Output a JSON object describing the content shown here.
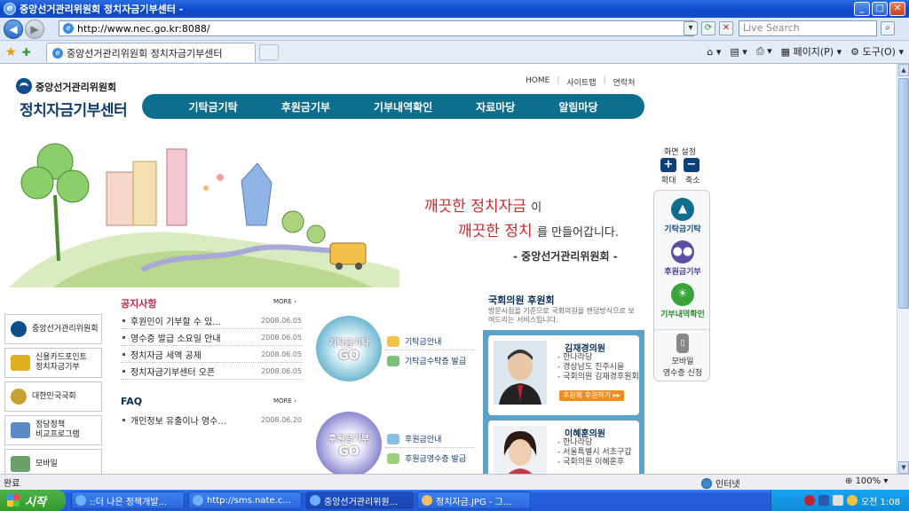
{
  "browser": {
    "window_title": "중앙선거관리위원회 정치자금기부센터 -",
    "url": "http://www.nec.go.kr:8088/",
    "search_placeholder": "Live Search",
    "tab_title": "중앙선거관리위원회 정치자금기부센터",
    "tools": {
      "page": "페이지(P)",
      "tools": "도구(O)"
    },
    "status_text": "완료",
    "zone": "인터넷",
    "zoom": "100%"
  },
  "header": {
    "org_name": "중앙선거관리위원회",
    "site_title": "정치자금기부센터",
    "top_links": [
      "HOME",
      "사이트맵",
      "연락처"
    ],
    "nav": [
      "기탁금기탁",
      "후원금기부",
      "기부내역확인",
      "자료마당",
      "알림마당"
    ]
  },
  "hero": {
    "line1_red": "깨끗한 정치자금",
    "line1_dark": "이",
    "line2_red": "깨끗한 정치",
    "line2_dark": "를 만들어갑니다.",
    "signature": "- 중앙선거관리위원회 -"
  },
  "quick_panel": {
    "screen_label": "화면 설정",
    "zoom_in": "확대",
    "zoom_out": "축소",
    "items": [
      {
        "label": "기탁금기탁",
        "icon": "deposit-icon",
        "color": "#0d6e8e"
      },
      {
        "label": "후원금기부",
        "icon": "people-icon",
        "color": "#5b4fa8"
      },
      {
        "label": "기부내역확인",
        "icon": "lightbulb-icon",
        "color": "#3aa43a"
      },
      {
        "label_line1": "모바일",
        "label_line2": "영수증 신청",
        "icon": "mobile-icon",
        "color": "#777777"
      }
    ]
  },
  "side_menu": [
    {
      "label_line1": "중앙선거관리위원회",
      "label_line2": "",
      "icon": "nec-logo-icon",
      "color": "#0f4e8a"
    },
    {
      "label_line1": "신용카드포인트",
      "label_line2": "정치자금기부",
      "icon": "card-icon",
      "color": "#e0b020"
    },
    {
      "label_line1": "대한민국국회",
      "label_line2": "",
      "icon": "assembly-icon",
      "color": "#c8a030"
    },
    {
      "label_line1": "정당정책",
      "label_line2": "비교프로그램",
      "icon": "document-icon",
      "color": "#5a8ac8"
    },
    {
      "label_line1": "모바일",
      "label_line2": "",
      "icon": "mobile-icon",
      "color": "#6aa06a"
    }
  ],
  "notice": {
    "title": "공지사항",
    "more": "MORE",
    "items": [
      {
        "text": "후원인이 기부할 수 있...",
        "date": "2008.06.05"
      },
      {
        "text": "영수증 발급 소요일 안내",
        "date": "2008.06.05"
      },
      {
        "text": "정치자금 세액 공제",
        "date": "2008.06.05"
      },
      {
        "text": "정치자금기부센터 오픈",
        "date": "2008.06.05"
      }
    ]
  },
  "faq": {
    "title": "FAQ",
    "more": "MORE",
    "items": [
      {
        "text": "개인정보 유출이나 영수...",
        "date": "2008.06.20"
      }
    ]
  },
  "donate": {
    "deposit_circle": "기탁금기탁",
    "support_circle": "후원금기부",
    "go": "GO",
    "deposit_links": [
      "기탁금안내",
      "기탁금수탁증 발급"
    ],
    "support_links": [
      "후원금안내",
      "후원금영수증 발급"
    ]
  },
  "members": {
    "title": "국회의원 후원회",
    "desc": "방문시점을 기준으로 국회의원을 랜덤방식으로 보여드리는 서비스입니다.",
    "cards": [
      {
        "name": "김재경의원",
        "info": [
          "한나라당",
          "경상남도 진주시을",
          "국회의원 김재경후원회"
        ],
        "button": "후원회 후원하기 ▸▸"
      },
      {
        "name": "이혜훈의원",
        "info": [
          "한나라당",
          "서울특별시 서초구갑",
          "국회의원 이혜훈후"
        ],
        "button": ""
      }
    ]
  },
  "taskbar": {
    "start": "시작",
    "tasks": [
      "::더 나은 정책개발...",
      "http://sms.nate.c...",
      "중앙선거관리위원...",
      "정치자금.JPG - 그..."
    ],
    "time": "오전 1:08"
  }
}
